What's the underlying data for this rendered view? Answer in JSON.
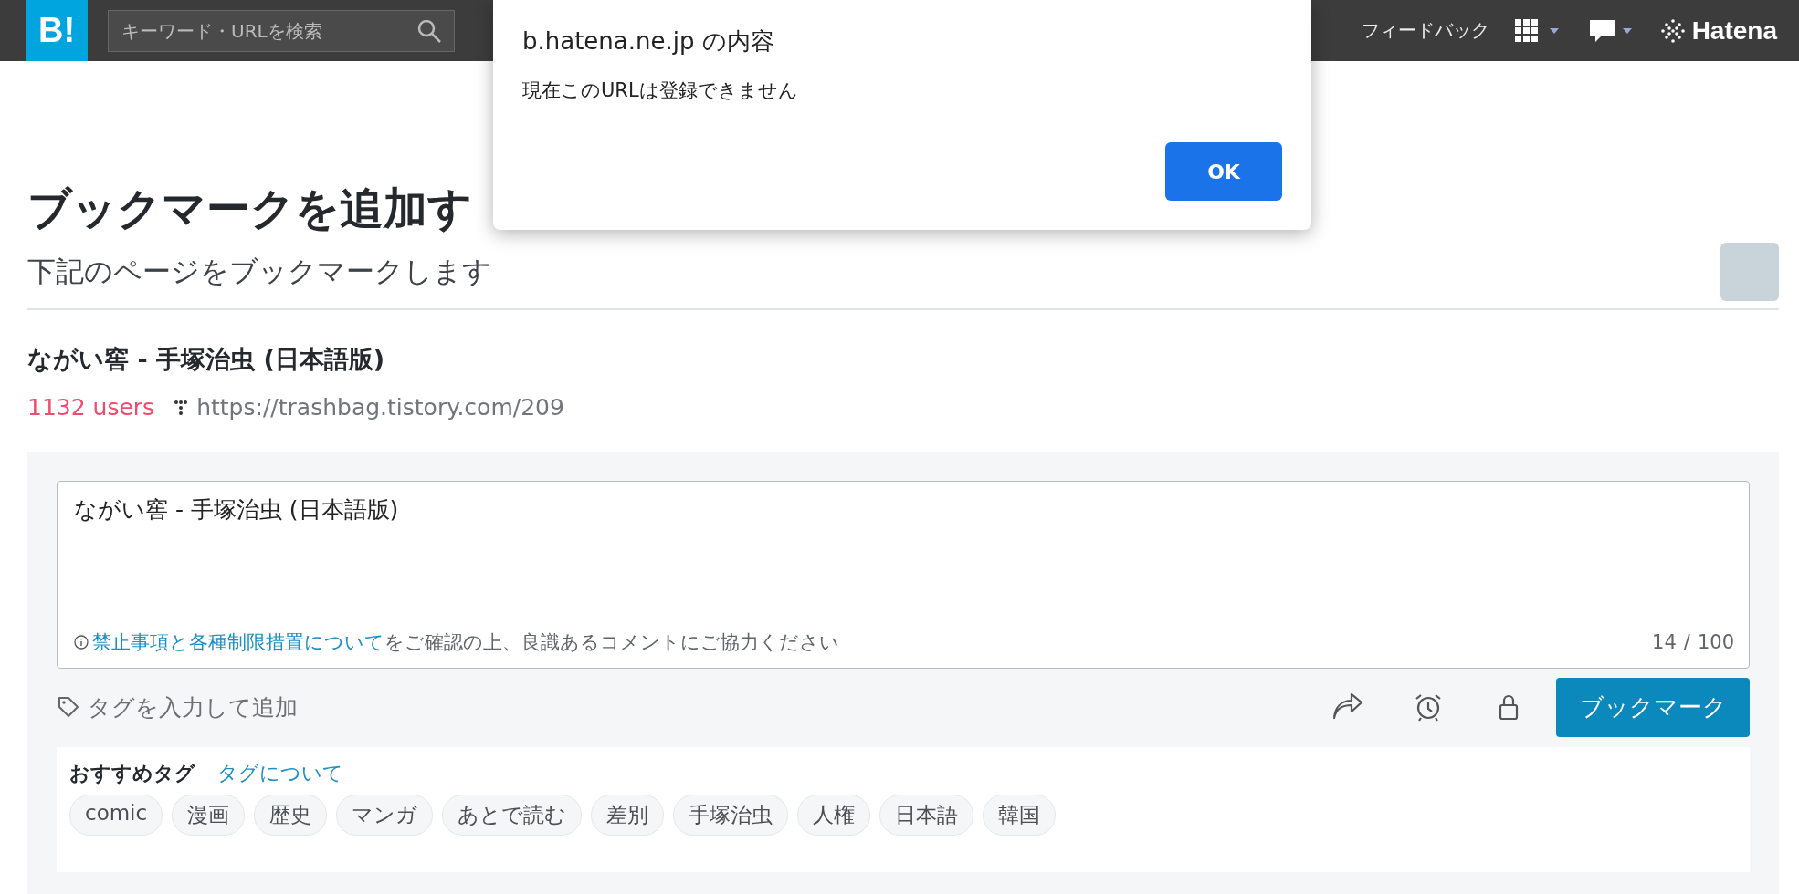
{
  "header": {
    "logo": "B!",
    "search": {
      "placeholder": "キーワード・URLを検索"
    },
    "feedback": "フィードバック",
    "brand": "Hatena"
  },
  "page": {
    "heading": "ブックマークを追加す",
    "subtitle": "下記のページをブックマークします"
  },
  "entry": {
    "title": "ながい窖 - 手塚治虫 (日本語版)",
    "users": "1132 users",
    "url": "https://trashbag.tistory.com/209"
  },
  "comment": {
    "value": "ながい窖 - 手塚治虫 (日本語版)",
    "notice_link": "禁止事項と各種制限措置について",
    "notice_rest": "をご確認の上、良識あるコメントにご協力ください",
    "count": "14",
    "separator": "/",
    "max": "100"
  },
  "tag_input": {
    "placeholder": "タグを入力して追加"
  },
  "submit": "ブックマーク",
  "recommended": {
    "title": "おすすめタグ",
    "about_link": "タグについて",
    "tags": [
      "comic",
      "漫画",
      "歴史",
      "マンガ",
      "あとで読む",
      "差別",
      "手塚治虫",
      "人権",
      "日本語",
      "韓国"
    ]
  },
  "dialog": {
    "title": "b.hatena.ne.jp の内容",
    "message": "現在このURLは登録できません",
    "ok": "OK"
  }
}
